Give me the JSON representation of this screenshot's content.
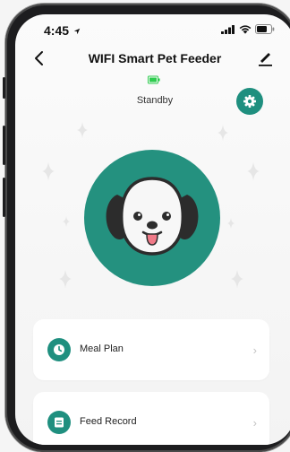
{
  "status_bar": {
    "time": "4:45"
  },
  "header": {
    "title": "WIFI Smart Pet Feeder"
  },
  "device": {
    "status": "Standby"
  },
  "menu": {
    "items": [
      {
        "label": "Meal Plan",
        "icon": "clock-icon"
      },
      {
        "label": "Feed Record",
        "icon": "record-icon"
      }
    ]
  },
  "colors": {
    "accent": "#24917f",
    "battery": "#2ecc4f"
  }
}
